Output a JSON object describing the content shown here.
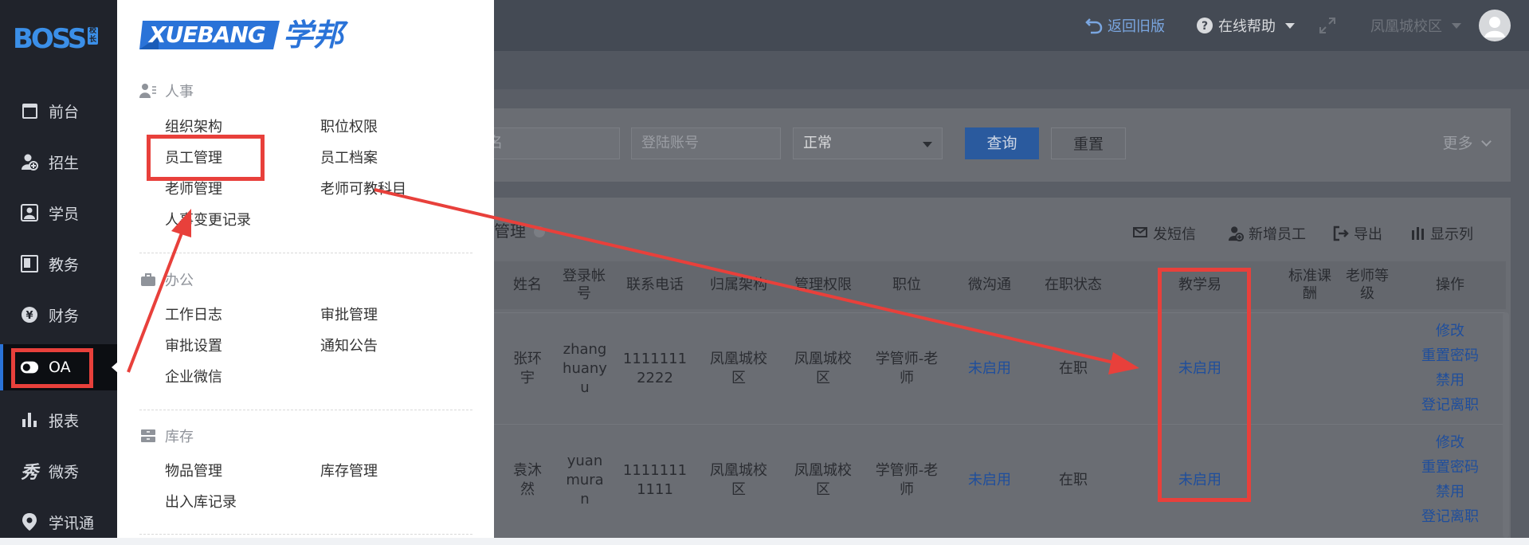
{
  "sidebar": {
    "logo": "BOSS",
    "logo_sub": "校长",
    "items": [
      {
        "label": "前台",
        "icon": "desk-icon"
      },
      {
        "label": "招生",
        "icon": "user-add-icon"
      },
      {
        "label": "学员",
        "icon": "student-icon"
      },
      {
        "label": "教务",
        "icon": "book-icon"
      },
      {
        "label": "财务",
        "icon": "yen-icon"
      },
      {
        "label": "OA",
        "icon": "toggle-icon"
      },
      {
        "label": "报表",
        "icon": "bar-chart-icon"
      },
      {
        "label": "微秀",
        "icon": "weixiu-icon"
      },
      {
        "label": "学讯通",
        "icon": "location-icon"
      }
    ],
    "active_index": 5
  },
  "header": {
    "back_label": "返回旧版",
    "help_label": "在线帮助",
    "campus_label": "凤凰城校区"
  },
  "filters": {
    "name_placeholder": "名",
    "account_placeholder": "登陆账号",
    "status_value": "正常",
    "query_label": "查询",
    "reset_label": "重置",
    "more_label": "更多"
  },
  "table_panel": {
    "title": "户管理",
    "actions": [
      "发短信",
      "新增员工",
      "导出",
      "显示列"
    ],
    "columns": [
      "姓名",
      "登录帐号",
      "联系电话",
      "归属架构",
      "管理权限",
      "职位",
      "微沟通",
      "在职状态",
      "教学易",
      "标准课酬",
      "老师等级",
      "操作"
    ],
    "rows": [
      {
        "name": "张环宇",
        "account": "zhanghuanyu",
        "phone": "11111112222",
        "org": "凤凰城校区",
        "perm": "凤凰城校区",
        "position": "学管师-老师",
        "wechat": "未启用",
        "status": "在职",
        "jiaoxueyi": "未启用",
        "ops": [
          "修改",
          "重置密码",
          "禁用",
          "登记离职"
        ]
      },
      {
        "name": "袁沐然",
        "account": "yuanmuran",
        "phone": "11111111111",
        "org": "凤凰城校区",
        "perm": "凤凰城校区",
        "position": "学管师-老师",
        "wechat": "未启用",
        "status": "在职",
        "jiaoxueyi": "未启用",
        "ops": [
          "修改",
          "重置密码",
          "禁用",
          "登记离职"
        ]
      }
    ]
  },
  "menu": {
    "logo_text": "XUEBANG",
    "logo_cn": "学邦",
    "sections": [
      {
        "title": "人事",
        "icon": "people-icon",
        "items": [
          "组织架构",
          "职位权限",
          "员工管理",
          "员工档案",
          "老师管理",
          "老师可教科目",
          "人事变更记录"
        ]
      },
      {
        "title": "办公",
        "icon": "briefcase-icon",
        "items": [
          "工作日志",
          "审批管理",
          "审批设置",
          "通知公告",
          "企业微信"
        ]
      },
      {
        "title": "库存",
        "icon": "inventory-icon",
        "items": [
          "物品管理",
          "库存管理",
          "出入库记录"
        ]
      }
    ]
  },
  "colors": {
    "accent": "#2a73d8",
    "annotation_red": "#e8403b",
    "sidebar_bg": "#20232b"
  }
}
